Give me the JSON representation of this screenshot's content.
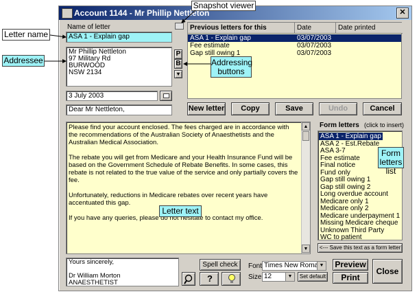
{
  "window": {
    "title": "Account 1144 - Mr Phillip Nettleton",
    "close_glyph": "✕"
  },
  "callouts": {
    "snapshot_viewer": "Snapshot viewer",
    "letter_name": "Letter name",
    "addressee": "Addressee",
    "addressing_buttons": "Addressing buttons",
    "form_letters_list": "Form letters list",
    "letter_text": "Letter text"
  },
  "labels": {
    "name_of_letter": "Name of letter",
    "previous_letters": "Previous letters for this account",
    "date": "Date",
    "date_printed": "Date printed",
    "form_letters": "Form letters",
    "click_to_insert": "(click to insert)",
    "font": "Font:",
    "size": "Size:"
  },
  "letter_name_value": "ASA 1 - Explain gap",
  "address_value": "Mr Phillip Nettleton\n97 Military Rd\nBURWOOD\nNSW 2134",
  "date_value": "3 July 2003",
  "salutation_value": "Dear Mr Nettleton,",
  "addr_buttons": {
    "p": "P",
    "b": "B",
    "dropdown": "▾"
  },
  "previous_letters": [
    {
      "name": "ASA 1 - Explain gap",
      "date": "03/07/2003",
      "printed": ""
    },
    {
      "name": "Fee estimate",
      "date": "03/07/2003",
      "printed": ""
    },
    {
      "name": "Gap still owing 1",
      "date": "03/07/2003",
      "printed": ""
    }
  ],
  "buttons": {
    "new_letter": "New letter",
    "copy": "Copy",
    "save": "Save",
    "undo": "Undo",
    "cancel": "Cancel",
    "save_form": "<--- Save this text as a form letter",
    "spell_check": "Spell check",
    "set_default": "Set default",
    "preview": "Preview",
    "print": "Print",
    "close": "Close"
  },
  "letter_body": "Please find your account enclosed. The fees charged are in accordance with the recommendations of the Australian Society of Anaesthetists and the Australian Medical Association.\n\nThe rebate you will get from Medicare and your Health Insurance Fund will be based on the Government Schedule of Rebate Benefits. In some cases, this rebate is not related to the true value of the service and only partially covers the fee.\n\nUnfortunately, reductions in Medicare rebates over recent years have accentuated this gap.\n\nIf you have any queries, please do not hesitate to contact my office.",
  "signature": "Yours sincerely,\n\nDr William Morton\nANAESTHETIST",
  "form_letters": [
    "ASA 1 - Explain gap",
    "ASA 2 - Est.Rebate",
    "ASA 3-7",
    "Fee estimate",
    "Final notice",
    "Fund only",
    "Gap still owing 1",
    "Gap still owing 2",
    "Long overdue account",
    "Medicare only 1",
    "Medicare only 2",
    "Medicare underpayment 1",
    "Missing Medicare cheque",
    "Unknown Third Party",
    "WC to patient"
  ],
  "font_value": "Times New Roman",
  "size_value": "12",
  "icons": {
    "magnifier": "search-icon",
    "question": "help-icon",
    "bulb": "lightbulb-icon",
    "calendar": "calendar-icon",
    "snapshot": "snapshot-icon"
  }
}
